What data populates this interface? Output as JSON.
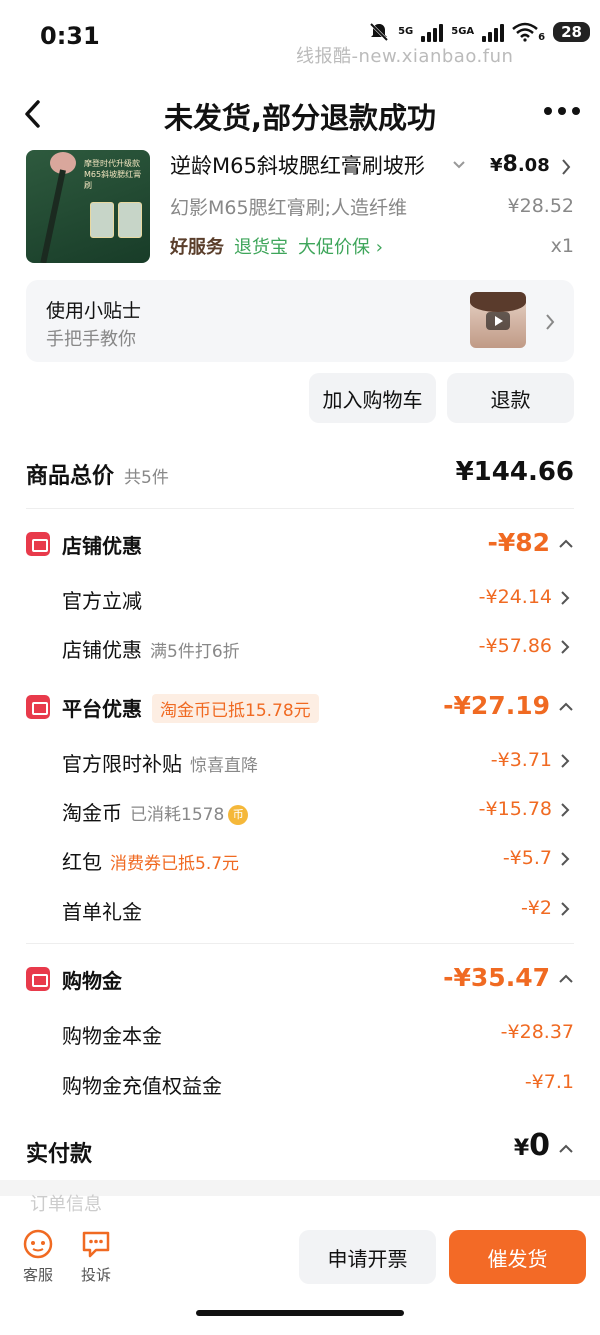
{
  "status_bar": {
    "time": "0:31",
    "network1": "5G",
    "network2": "5GA",
    "wifi_badge": "6",
    "battery": "28"
  },
  "watermark": "线报酷-new.xianbao.fun",
  "nav": {
    "title": "未发货,部分退款成功"
  },
  "product": {
    "thumb_text": "摩登时代升级款\nM65斜坡腮红膏刷",
    "title": "逆龄M65斜坡腮红膏刷坡形",
    "price_symbol": "¥",
    "price_int": "8",
    "price_dec": ".08",
    "spec": "幻影M65腮红膏刷;人造纤维",
    "original_price": "¥28.52",
    "service_good": "好服务",
    "service_return": "退货宝",
    "service_protect": "大促价保 ›",
    "quantity": "x1"
  },
  "tips": {
    "title": "使用小贴士",
    "subtitle": "手把手教你"
  },
  "actions": {
    "add_cart": "加入购物车",
    "refund": "退款"
  },
  "summary": {
    "label": "商品总价",
    "count": "共5件",
    "total": "¥144.66"
  },
  "store_discount": {
    "label": "店铺优惠",
    "value": "-¥82",
    "items": [
      {
        "label": "官方立减",
        "note": "",
        "value": "-¥24.14"
      },
      {
        "label": "店铺优惠",
        "note": "满5件打6折",
        "value": "-¥57.86"
      }
    ]
  },
  "platform_discount": {
    "label": "平台优惠",
    "pill": "淘金币已抵15.78元",
    "value": "-¥27.19",
    "items": [
      {
        "label": "官方限时补贴",
        "note": "惊喜直降",
        "value": "-¥3.71"
      },
      {
        "label": "淘金币",
        "note": "已消耗1578",
        "value": "-¥15.78"
      },
      {
        "label": "红包",
        "note": "消费券已抵5.7元",
        "value": "-¥5.7"
      },
      {
        "label": "首单礼金",
        "note": "",
        "value": "-¥2"
      }
    ]
  },
  "shopping_gold": {
    "label": "购物金",
    "value": "-¥35.47",
    "items": [
      {
        "label": "购物金本金",
        "value": "-¥28.37"
      },
      {
        "label": "购物金充值权益金",
        "value": "-¥7.1"
      }
    ]
  },
  "paid": {
    "label": "实付款",
    "symbol": "¥",
    "value": "0"
  },
  "bottom": {
    "ghost_text": "订单信息",
    "service_label": "客服",
    "complain_label": "投诉",
    "invoice_button": "申请开票",
    "urge_button": "催发货"
  },
  "colors": {
    "accent": "#f06a22",
    "urge_button": "#f36a26",
    "green": "#3ea55a",
    "red_icon": "#e83a4b"
  }
}
